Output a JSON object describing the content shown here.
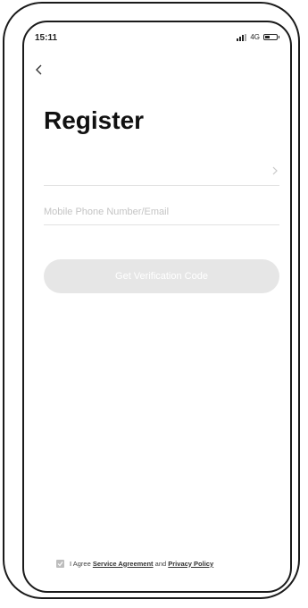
{
  "status_bar": {
    "time": "15:11",
    "network": "4G"
  },
  "header": {
    "back_icon": "chevron-left-icon",
    "title": "Register"
  },
  "form": {
    "region_icon": "chevron-right-icon",
    "phone_placeholder": "Mobile Phone Number/Email",
    "verify_button_label": "Get Verification Code"
  },
  "agreement": {
    "prefix": "I Agree",
    "service_link": "Service Agreement",
    "and": "and",
    "privacy_link": "Privacy Policy",
    "checked": true
  },
  "colors": {
    "button_disabled": "#e6e6e6",
    "divider": "#e2e2e2",
    "placeholder": "#c4c4c4"
  }
}
